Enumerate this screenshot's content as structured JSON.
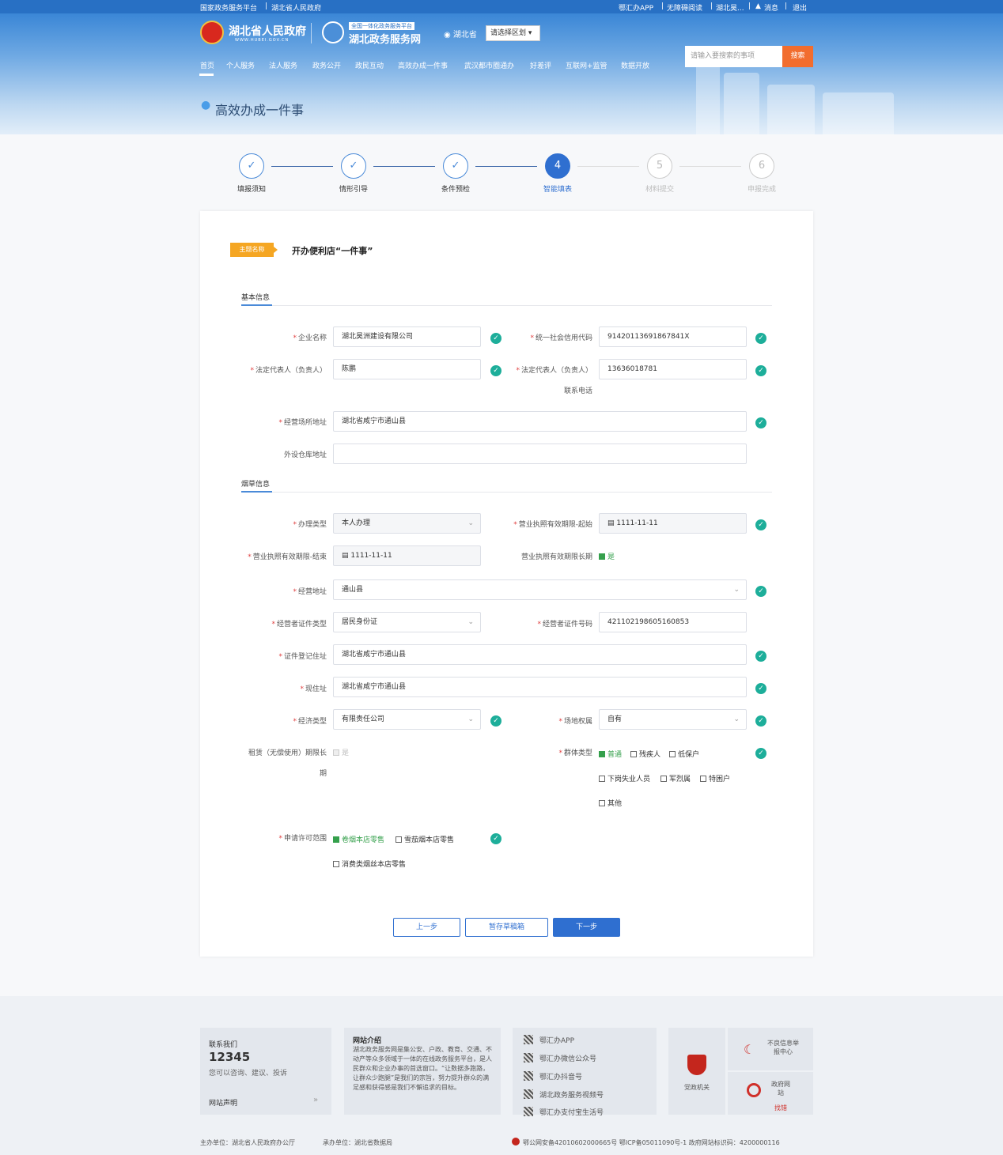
{
  "topbar": {
    "left_links": [
      "国家政务服务平台",
      "湖北省人民政府"
    ],
    "right_links": [
      "鄂汇办APP",
      "无障碍阅读",
      "湖北昊...",
      "消息",
      "退出"
    ]
  },
  "header": {
    "gov_name": "湖北省人民政府",
    "gov_sub": "WWW.HUBEI.GOV.CN",
    "portal_badge": "全国一体化政务服务平台",
    "portal_name": "湖北政务服务网",
    "location": "湖北省",
    "region_select": "请选择区划",
    "search_placeholder": "请输入要搜索的事项",
    "search_button": "搜索",
    "nav": [
      "首页",
      "个人服务",
      "法人服务",
      "政务公开",
      "政民互动",
      "高效办成一件事",
      "武汉都市圈通办",
      "好差评",
      "互联网+监管",
      "数据开放"
    ],
    "page_title": "高效办成一件事"
  },
  "steps": [
    {
      "label": "填报须知",
      "state": "done"
    },
    {
      "label": "情形引导",
      "state": "done"
    },
    {
      "label": "条件预检",
      "state": "done"
    },
    {
      "label": "智能填表",
      "state": "active",
      "num": "4"
    },
    {
      "label": "材料提交",
      "state": "pending",
      "num": "5"
    },
    {
      "label": "申报完成",
      "state": "pending",
      "num": "6"
    }
  ],
  "form": {
    "theme_tag": "主题名称",
    "theme_name": "开办便利店“一件事”",
    "section_basic": "基本信息",
    "section_tobacco": "烟草信息",
    "company_name_label": "企业名称",
    "company_name": "湖北昊洲建设有限公司",
    "credit_code_label": "统一社会信用代码",
    "credit_code": "91420113691867841X",
    "legal_rep_label": "法定代表人（负责人）",
    "legal_rep": "陈鹏",
    "legal_phone_label": "法定代表人（负责人）",
    "legal_phone_label2": "联系电话",
    "legal_phone": "13636018781",
    "biz_address_label": "经营场所地址",
    "biz_address": "湖北省咸宁市通山县",
    "warehouse_label": "外设仓库地址",
    "warehouse": "",
    "handle_type_label": "办理类型",
    "handle_type": "本人办理",
    "license_start_label": "营业执照有效期限-起始",
    "license_start": "1111-11-11",
    "license_end_label": "营业执照有效期限-结束",
    "license_end": "1111-11-11",
    "license_long_label": "营业执照有效期限长期",
    "license_long": "是",
    "op_address_label": "经营地址",
    "op_address": "通山县",
    "id_type_label": "经营者证件类型",
    "id_type": "居民身份证",
    "id_no_label": "经营者证件号码",
    "id_no": "421102198605160853",
    "id_address_label": "证件登记住址",
    "id_address": "湖北省咸宁市通山县",
    "cur_address_label": "现住址",
    "cur_address": "湖北省咸宁市通山县",
    "econ_type_label": "经济类型",
    "econ_type": "有限责任公司",
    "site_right_label": "场地权属",
    "site_right": "自有",
    "lease_label": "租赁（无偿使用）期限长",
    "lease_label2": "期",
    "lease_value": "是",
    "group_label": "群体类型",
    "group_options": [
      "普通",
      "残疾人",
      "低保户",
      "下岗失业人员",
      "军烈属",
      "特困户",
      "其他"
    ],
    "scope_label": "申请许可范围",
    "scope_options": [
      "卷烟本店零售",
      "雪茄烟本店零售",
      "消费类烟丝本店零售"
    ],
    "btn_prev": "上一步",
    "btn_draft": "暂存草稿箱",
    "btn_next": "下一步"
  },
  "footer": {
    "contact_title": "联系我们",
    "contact_number": "12345",
    "contact_desc": "您可以咨询、建议、投诉",
    "statement": "网站声明",
    "about_title": "网站介绍",
    "about_text": "湖北政务服务网是集公安、户政、教育、交通、不动产等众多领域于一体的在线政务服务平台，是人民群众和企业办事的首选窗口。“让数据多跑路，让群众少跑腿”是我们的宗旨，努力提升群众的满足感和获得感是我们不懈追求的目标。",
    "apps": [
      "鄂汇办APP",
      "鄂汇办微信公众号",
      "鄂汇办抖音号",
      "湖北政务服务视频号",
      "鄂汇办支付宝生活号"
    ],
    "party_label": "党政机关",
    "report_label": "不良信息举报中心",
    "error_label1": "政府网站",
    "error_label2": "找错",
    "host": "主办单位：湖北省人民政府办公厅",
    "operator": "承办单位：湖北省数据局",
    "icp": "鄂公网安备42010602000665号 鄂ICP备05011090号-1 政府网站标识码：4200000116"
  },
  "colors": {
    "accent": "#2f6fd0",
    "ok": "#1dae9a",
    "tag": "#f5a623"
  }
}
